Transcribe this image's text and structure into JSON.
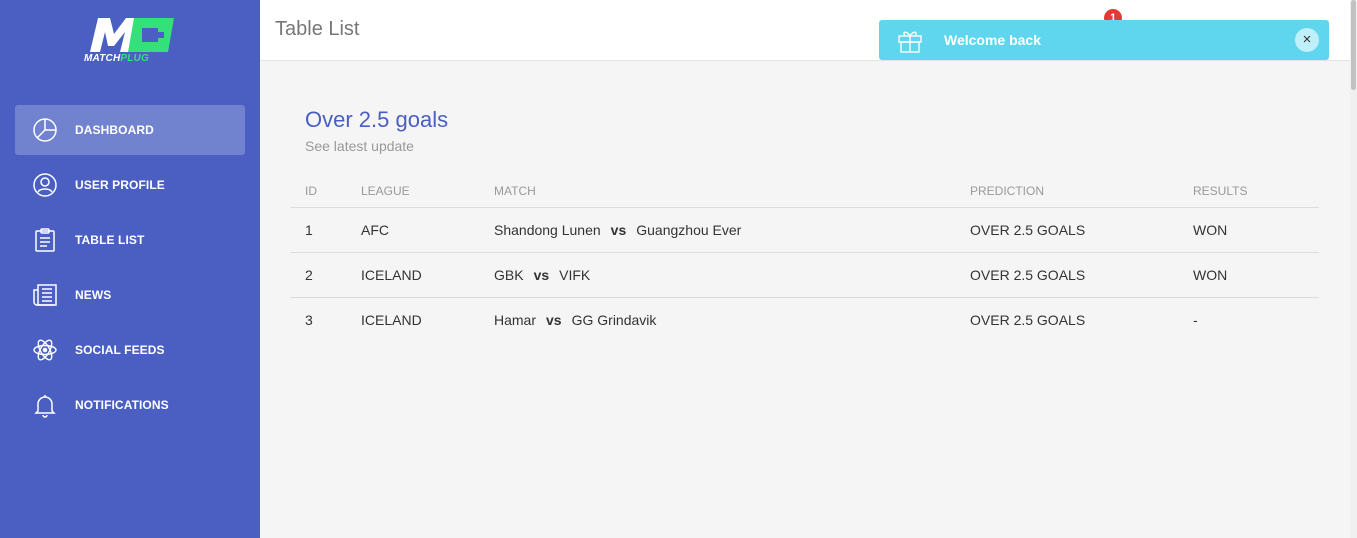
{
  "brand": {
    "name_prefix": "MATCH",
    "name_suffix": "PLUG",
    "colors": {
      "primary": "#4a5fc1",
      "accent": "#33e07a"
    }
  },
  "sidebar": {
    "items": [
      {
        "label": "DASHBOARD",
        "icon": "pie-chart-icon",
        "active": true
      },
      {
        "label": "USER PROFILE",
        "icon": "user-icon",
        "active": false
      },
      {
        "label": "TABLE LIST",
        "icon": "clipboard-icon",
        "active": false
      },
      {
        "label": "NEWS",
        "icon": "newspaper-icon",
        "active": false
      },
      {
        "label": "SOCIAL FEEDS",
        "icon": "atom-icon",
        "active": false
      },
      {
        "label": "NOTIFICATIONS",
        "icon": "bell-icon",
        "active": false
      }
    ]
  },
  "header": {
    "title": "Table List",
    "notification_count": "1"
  },
  "toast": {
    "message": "Welcome back",
    "close": "×",
    "icon": "gift-icon",
    "color": "#5fd6ee"
  },
  "card": {
    "title": "Over 2.5 goals",
    "subtitle": "See latest update"
  },
  "table": {
    "columns": [
      "ID",
      "LEAGUE",
      "MATCH",
      "PREDICTION",
      "RESULTS"
    ],
    "rows": [
      {
        "id": "1",
        "league": "AFC",
        "home": "Shandong Lunen",
        "vs": "vs",
        "away": "Guangzhou Ever",
        "prediction": "OVER 2.5 GOALS",
        "result": "WON"
      },
      {
        "id": "2",
        "league": "ICELAND",
        "home": "GBK",
        "vs": "vs",
        "away": "VIFK",
        "prediction": "OVER 2.5 GOALS",
        "result": "WON"
      },
      {
        "id": "3",
        "league": "ICELAND",
        "home": "Hamar",
        "vs": "vs",
        "away": "GG Grindavik",
        "prediction": "OVER 2.5 GOALS",
        "result": "-"
      }
    ]
  }
}
